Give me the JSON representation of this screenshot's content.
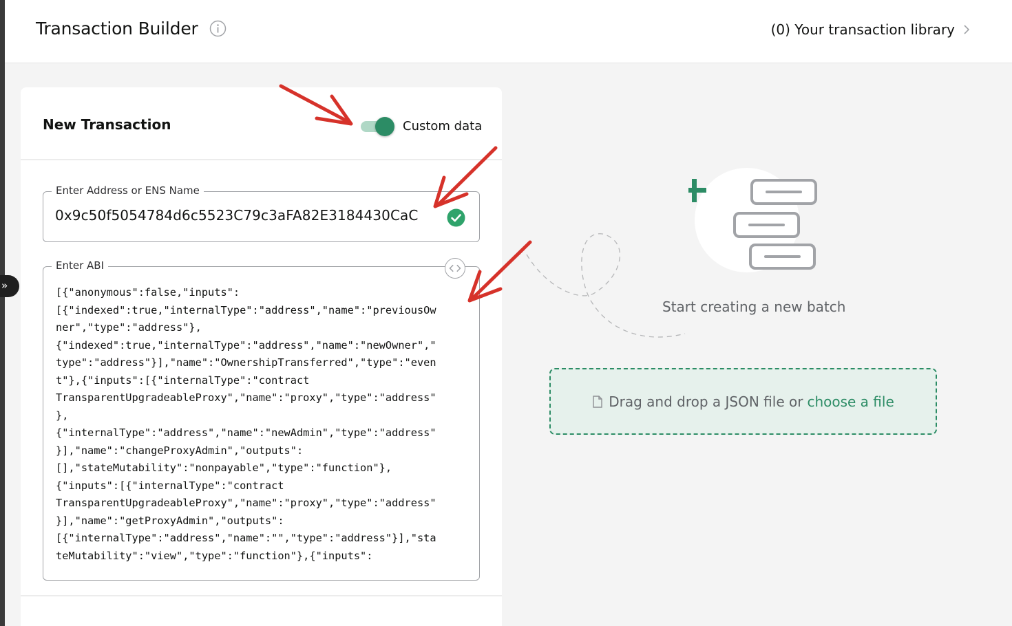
{
  "header": {
    "title": "Transaction Builder",
    "library_link": "(0) Your transaction library"
  },
  "new_transaction": {
    "title": "New Transaction",
    "custom_data_label": "Custom data",
    "custom_data_enabled": true,
    "address_label": "Enter Address or ENS Name",
    "address_value": "0x9c50f5054784d6c5523C79c3aFA82E3184430CaC",
    "abi_label": "Enter ABI",
    "abi_lines": [
      "[{\"anonymous\":false,\"inputs\":",
      "[{\"indexed\":true,\"internalType\":\"address\",\"name\":\"previousOw",
      "ner\",\"type\":\"address\"},",
      "{\"indexed\":true,\"internalType\":\"address\",\"name\":\"newOwner\",\"",
      "type\":\"address\"}],\"name\":\"OwnershipTransferred\",\"type\":\"even",
      "t\"},{\"inputs\":[{\"internalType\":\"contract",
      "TransparentUpgradeableProxy\",\"name\":\"proxy\",\"type\":\"address\"",
      "},",
      "{\"internalType\":\"address\",\"name\":\"newAdmin\",\"type\":\"address\"",
      "}],\"name\":\"changeProxyAdmin\",\"outputs\":",
      "[],\"stateMutability\":\"nonpayable\",\"type\":\"function\"},",
      "{\"inputs\":[{\"internalType\":\"contract",
      "TransparentUpgradeableProxy\",\"name\":\"proxy\",\"type\":\"address\"",
      "}],\"name\":\"getProxyAdmin\",\"outputs\":",
      "[{\"internalType\":\"address\",\"name\":\"\",\"type\":\"address\"}],\"sta",
      "teMutability\":\"view\",\"type\":\"function\"},{\"inputs\":"
    ]
  },
  "batch": {
    "empty_text": "Start creating a new batch",
    "drop_text": "Drag and drop a JSON file or",
    "choose_link": "choose a file"
  },
  "icons": [
    "expand-sidebar-icon",
    "info-icon",
    "chevron-right-icon",
    "check-circle-icon",
    "code-icon",
    "batch-illustration-icon",
    "file-icon",
    "annotation-arrow"
  ],
  "colors": {
    "accent": "#2c8c65",
    "toggle_track": "#b0d8c6",
    "dropzone_bg": "#e6f1ec",
    "annotation_arrow": "#d6322a"
  }
}
